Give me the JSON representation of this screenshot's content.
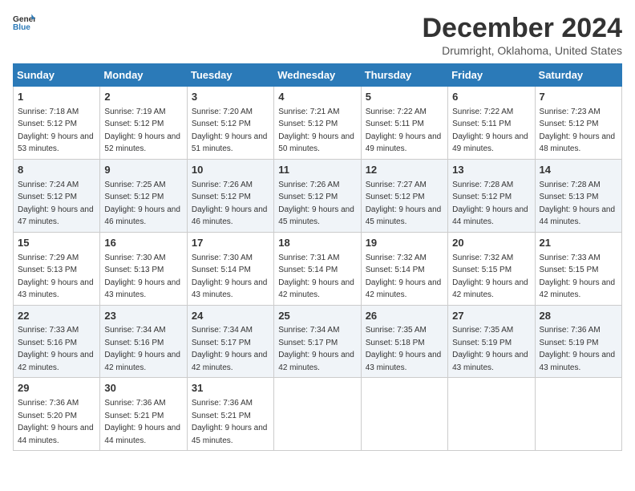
{
  "logo": {
    "line1": "General",
    "line2": "Blue"
  },
  "title": "December 2024",
  "subtitle": "Drumright, Oklahoma, United States",
  "headers": [
    "Sunday",
    "Monday",
    "Tuesday",
    "Wednesday",
    "Thursday",
    "Friday",
    "Saturday"
  ],
  "weeks": [
    [
      {
        "day": "1",
        "sunrise": "7:18 AM",
        "sunset": "5:12 PM",
        "daylight": "9 hours and 53 minutes."
      },
      {
        "day": "2",
        "sunrise": "7:19 AM",
        "sunset": "5:12 PM",
        "daylight": "9 hours and 52 minutes."
      },
      {
        "day": "3",
        "sunrise": "7:20 AM",
        "sunset": "5:12 PM",
        "daylight": "9 hours and 51 minutes."
      },
      {
        "day": "4",
        "sunrise": "7:21 AM",
        "sunset": "5:12 PM",
        "daylight": "9 hours and 50 minutes."
      },
      {
        "day": "5",
        "sunrise": "7:22 AM",
        "sunset": "5:11 PM",
        "daylight": "9 hours and 49 minutes."
      },
      {
        "day": "6",
        "sunrise": "7:22 AM",
        "sunset": "5:11 PM",
        "daylight": "9 hours and 49 minutes."
      },
      {
        "day": "7",
        "sunrise": "7:23 AM",
        "sunset": "5:12 PM",
        "daylight": "9 hours and 48 minutes."
      }
    ],
    [
      {
        "day": "8",
        "sunrise": "7:24 AM",
        "sunset": "5:12 PM",
        "daylight": "9 hours and 47 minutes."
      },
      {
        "day": "9",
        "sunrise": "7:25 AM",
        "sunset": "5:12 PM",
        "daylight": "9 hours and 46 minutes."
      },
      {
        "day": "10",
        "sunrise": "7:26 AM",
        "sunset": "5:12 PM",
        "daylight": "9 hours and 46 minutes."
      },
      {
        "day": "11",
        "sunrise": "7:26 AM",
        "sunset": "5:12 PM",
        "daylight": "9 hours and 45 minutes."
      },
      {
        "day": "12",
        "sunrise": "7:27 AM",
        "sunset": "5:12 PM",
        "daylight": "9 hours and 45 minutes."
      },
      {
        "day": "13",
        "sunrise": "7:28 AM",
        "sunset": "5:12 PM",
        "daylight": "9 hours and 44 minutes."
      },
      {
        "day": "14",
        "sunrise": "7:28 AM",
        "sunset": "5:13 PM",
        "daylight": "9 hours and 44 minutes."
      }
    ],
    [
      {
        "day": "15",
        "sunrise": "7:29 AM",
        "sunset": "5:13 PM",
        "daylight": "9 hours and 43 minutes."
      },
      {
        "day": "16",
        "sunrise": "7:30 AM",
        "sunset": "5:13 PM",
        "daylight": "9 hours and 43 minutes."
      },
      {
        "day": "17",
        "sunrise": "7:30 AM",
        "sunset": "5:14 PM",
        "daylight": "9 hours and 43 minutes."
      },
      {
        "day": "18",
        "sunrise": "7:31 AM",
        "sunset": "5:14 PM",
        "daylight": "9 hours and 42 minutes."
      },
      {
        "day": "19",
        "sunrise": "7:32 AM",
        "sunset": "5:14 PM",
        "daylight": "9 hours and 42 minutes."
      },
      {
        "day": "20",
        "sunrise": "7:32 AM",
        "sunset": "5:15 PM",
        "daylight": "9 hours and 42 minutes."
      },
      {
        "day": "21",
        "sunrise": "7:33 AM",
        "sunset": "5:15 PM",
        "daylight": "9 hours and 42 minutes."
      }
    ],
    [
      {
        "day": "22",
        "sunrise": "7:33 AM",
        "sunset": "5:16 PM",
        "daylight": "9 hours and 42 minutes."
      },
      {
        "day": "23",
        "sunrise": "7:34 AM",
        "sunset": "5:16 PM",
        "daylight": "9 hours and 42 minutes."
      },
      {
        "day": "24",
        "sunrise": "7:34 AM",
        "sunset": "5:17 PM",
        "daylight": "9 hours and 42 minutes."
      },
      {
        "day": "25",
        "sunrise": "7:34 AM",
        "sunset": "5:17 PM",
        "daylight": "9 hours and 42 minutes."
      },
      {
        "day": "26",
        "sunrise": "7:35 AM",
        "sunset": "5:18 PM",
        "daylight": "9 hours and 43 minutes."
      },
      {
        "day": "27",
        "sunrise": "7:35 AM",
        "sunset": "5:19 PM",
        "daylight": "9 hours and 43 minutes."
      },
      {
        "day": "28",
        "sunrise": "7:36 AM",
        "sunset": "5:19 PM",
        "daylight": "9 hours and 43 minutes."
      }
    ],
    [
      {
        "day": "29",
        "sunrise": "7:36 AM",
        "sunset": "5:20 PM",
        "daylight": "9 hours and 44 minutes."
      },
      {
        "day": "30",
        "sunrise": "7:36 AM",
        "sunset": "5:21 PM",
        "daylight": "9 hours and 44 minutes."
      },
      {
        "day": "31",
        "sunrise": "7:36 AM",
        "sunset": "5:21 PM",
        "daylight": "9 hours and 45 minutes."
      },
      null,
      null,
      null,
      null
    ]
  ],
  "labels": {
    "sunrise": "Sunrise:",
    "sunset": "Sunset:",
    "daylight": "Daylight:"
  }
}
